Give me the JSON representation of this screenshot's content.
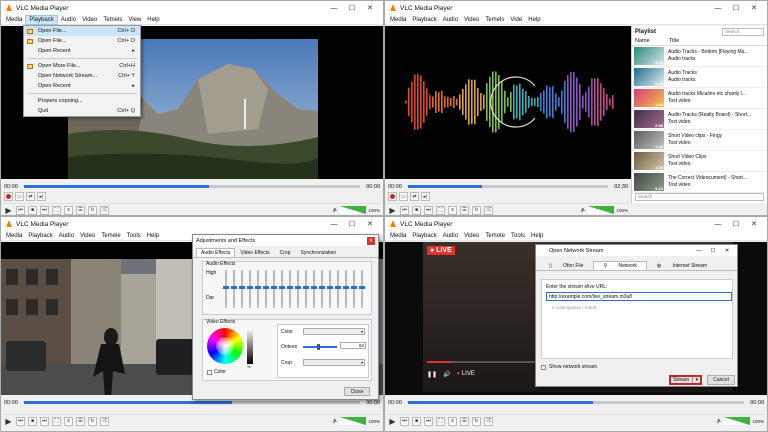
{
  "app_title": "VLC Media Player",
  "menu": [
    "Media",
    "Playback",
    "Audio",
    "Video",
    "Temels",
    "View",
    "Help"
  ],
  "menu_tr": [
    "Media",
    "Playback",
    "Audio",
    "Video",
    "Temels",
    "Vide",
    "Help"
  ],
  "menu_bl": [
    "Media",
    "Playback",
    "Audio",
    "Video",
    "Temele",
    "Tools",
    "Help"
  ],
  "menu_br": [
    "Media",
    "Playback",
    "Audio",
    "Video",
    "Temote",
    "Tools",
    "Help"
  ],
  "colors": {
    "accent": "#2d6ed8",
    "volume": "#3fb23f",
    "live": "#e0332e",
    "vlc_orange": "#f08000"
  },
  "media_menu": [
    {
      "label": "Open File...",
      "key": "Ctrl+ O",
      "hl": true
    },
    {
      "label": "Open File...",
      "key": "Ctrl+ O"
    },
    {
      "label": "Open Recent",
      "key": "▸"
    },
    {
      "sep": true
    },
    {
      "label": "Open More File...",
      "key": "Ctrl+H"
    },
    {
      "label": "Open Network Stream...",
      "key": "Ctrl+ Y"
    },
    {
      "label": "Open Recent",
      "key": "▸"
    },
    {
      "sep": true
    },
    {
      "label": "Propers copoing...",
      "key": ""
    },
    {
      "label": "Quit",
      "key": "Ctrl+ Q"
    }
  ],
  "players": {
    "tl": {
      "time_start": "00:00",
      "time_end": "00:00",
      "progress": 0.55,
      "volume": "100%"
    },
    "tr": {
      "time_start": "00:00",
      "time_end": "02:30",
      "progress": 0.37,
      "volume": "100%"
    },
    "bl": {
      "time_start": "00:00",
      "time_end": "00:00",
      "progress": 0.62,
      "volume": "100%"
    },
    "br": {
      "time_start": "00:00",
      "time_end": "00:00",
      "progress": 0.55,
      "volume": "100%"
    }
  },
  "playlist": {
    "title": "Playlist",
    "search_placeholder": "Search",
    "col_name": "Name",
    "col_title": "Title",
    "bottom_search": "Search",
    "items": [
      {
        "t1": "Audio Tracks - Bottom [Flaying Mu...",
        "t2": "Audio tracks",
        "dur": "4:55",
        "c1": "#2a8a7a",
        "c2": "#d9e7ea"
      },
      {
        "t1": "Audio Tracks",
        "t2": "Audio tracks",
        "dur": "3:35",
        "c1": "#1c6b8a",
        "c2": "#e7eef0"
      },
      {
        "t1": "Audio tracks Micaline etc charity l...",
        "t2": "Tost video",
        "dur": "1:26",
        "c1": "#d23e7a",
        "c2": "#f7c244"
      },
      {
        "t1": "Audio Tracks (Realty Board) - Short...",
        "t2": "Tost video",
        "dur": "2:58",
        "c1": "#3c2f4a",
        "c2": "#a86b8c"
      },
      {
        "t1": "Short Video clips - Fingy",
        "t2": "Tost video",
        "dur": "1:08",
        "c1": "#5a5a5a",
        "c2": "#c4c4c4"
      },
      {
        "t1": "Short Video Clips",
        "t2": "Tost video",
        "dur": "1:35",
        "c1": "#6b5a3d",
        "c2": "#d4c8b0"
      },
      {
        "t1": "The Correct Videocument) - Short...",
        "t2": "Tost video",
        "dur": "3:21",
        "c1": "#444",
        "c2": "#8aa08a"
      }
    ]
  },
  "adjust": {
    "title": "Adjustments and Effects",
    "tabs": [
      "Audio Effects",
      "Video Effects",
      "Crop",
      "Synchronization"
    ],
    "audio_label": "Audio Effects",
    "high": "High",
    "low": "Dar",
    "eq": [
      0.45,
      0.45,
      0.45,
      0.45,
      0.45,
      0.45,
      0.45,
      0.45,
      0.45,
      0.45,
      0.45,
      0.45,
      0.45,
      0.45,
      0.45,
      0.45,
      0.45,
      0.45
    ],
    "video_label": "Video Effects",
    "color_label": "Color",
    "color_check": "Color",
    "brightness_label": "Onteen",
    "brightness_value": "62",
    "crop_label": "Crop",
    "close": "Close"
  },
  "live_badge": "LIVE",
  "live_text": "LIVE",
  "network": {
    "title": "Open Network Stream",
    "tabs": [
      "Ofon File",
      "Network",
      "Internet Stream"
    ],
    "prompt": "Enter the stream elive URL:",
    "url": "http://example.com/live_stream.m3u8",
    "hint": "to exampleexe./.m3u8",
    "show_label": "Show network stream",
    "stream_btn": "Stream",
    "cancel_btn": "Cancel"
  }
}
